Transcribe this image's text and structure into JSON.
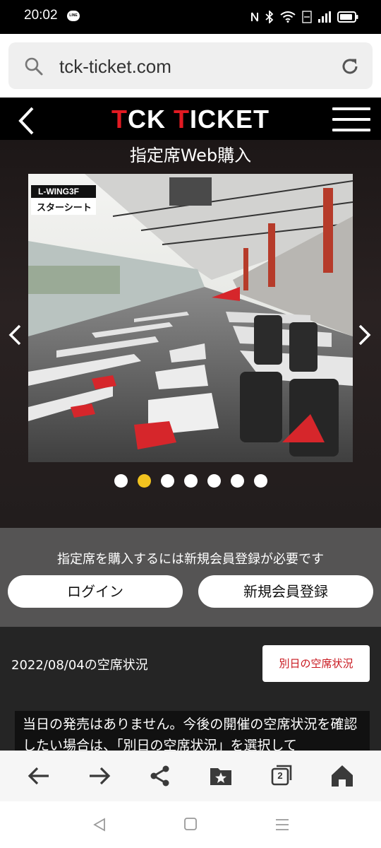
{
  "status_bar": {
    "time": "20:02",
    "line_label": "LINE",
    "icons": [
      "nfc-icon",
      "bluetooth-icon",
      "wifi-icon",
      "volte-icon",
      "signal-icon",
      "battery-icon"
    ]
  },
  "browser": {
    "url": "tck-ticket.com",
    "tab_count": "2"
  },
  "site": {
    "logo_parts": [
      "T",
      "CK ",
      "T",
      "ICKET"
    ],
    "page_title": "指定席Web購入",
    "slide": {
      "tag_top": "L-WING3F",
      "tag_bottom": "スターシート"
    },
    "carousel": {
      "dot_count": 7,
      "active_index": 1
    },
    "login_panel": {
      "note": "指定席を購入するには新規会員登録が必要です",
      "login_label": "ログイン",
      "register_label": "新規会員登録"
    },
    "availability": {
      "date_label": "2022/08/04の空席状況",
      "other_day_label": "別日の空席状況",
      "notice": "当日の発売はありません。今後の開催の空席状況を確認したい場合は、「別日の空席状況」を選択して"
    }
  },
  "colors": {
    "accent_red": "#e11a22",
    "active_dot": "#f2c31f",
    "panel_gray": "#555454"
  }
}
